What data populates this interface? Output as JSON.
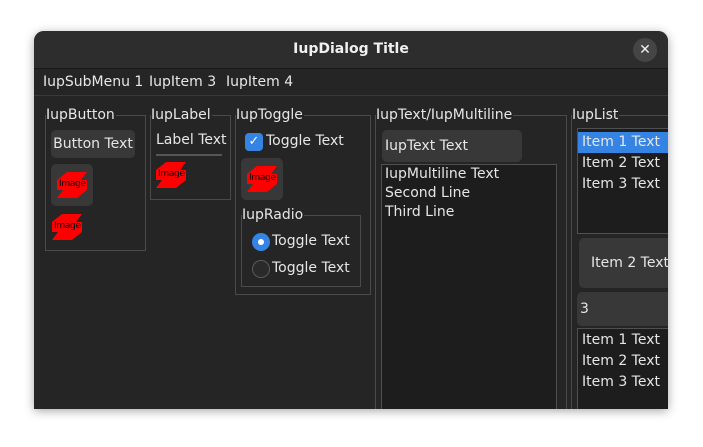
{
  "window": {
    "title": "IupDialog Title"
  },
  "menu": {
    "items": [
      "IupSubMenu 1",
      "IupItem 3",
      "IupItem 4"
    ]
  },
  "button_frame": {
    "title": "IupButton",
    "button_text": "Button Text",
    "image_label": "Image"
  },
  "label_frame": {
    "title": "IupLabel",
    "label_text": "Label Text",
    "image_label": "Image"
  },
  "toggle_frame": {
    "title": "IupToggle",
    "toggle_text": "Toggle Text",
    "image_label": "Image",
    "radio": {
      "title": "IupRadio",
      "options": [
        {
          "label": "Toggle Text",
          "selected": true
        },
        {
          "label": "Toggle Text",
          "selected": false
        }
      ]
    }
  },
  "text_frame": {
    "title": "IupText/IupMultiline",
    "text_value": "IupText Text",
    "multiline_lines": [
      "IupMultiline Text",
      "Second Line",
      "Third Line"
    ]
  },
  "list_frame": {
    "title": "IupList",
    "list1": {
      "items": [
        "Item 1 Text",
        "Item 2 Text",
        "Item 3 Text"
      ],
      "selected_index": 0
    },
    "dropdown_value": "Item 2 Text",
    "edit_value": "3",
    "list2": {
      "items": [
        "Item 1 Text",
        "Item 2 Text",
        "Item 3 Text"
      ]
    }
  },
  "colors": {
    "accent": "#3584e4",
    "window_bg": "#252525",
    "image_red": "#ff0000"
  }
}
